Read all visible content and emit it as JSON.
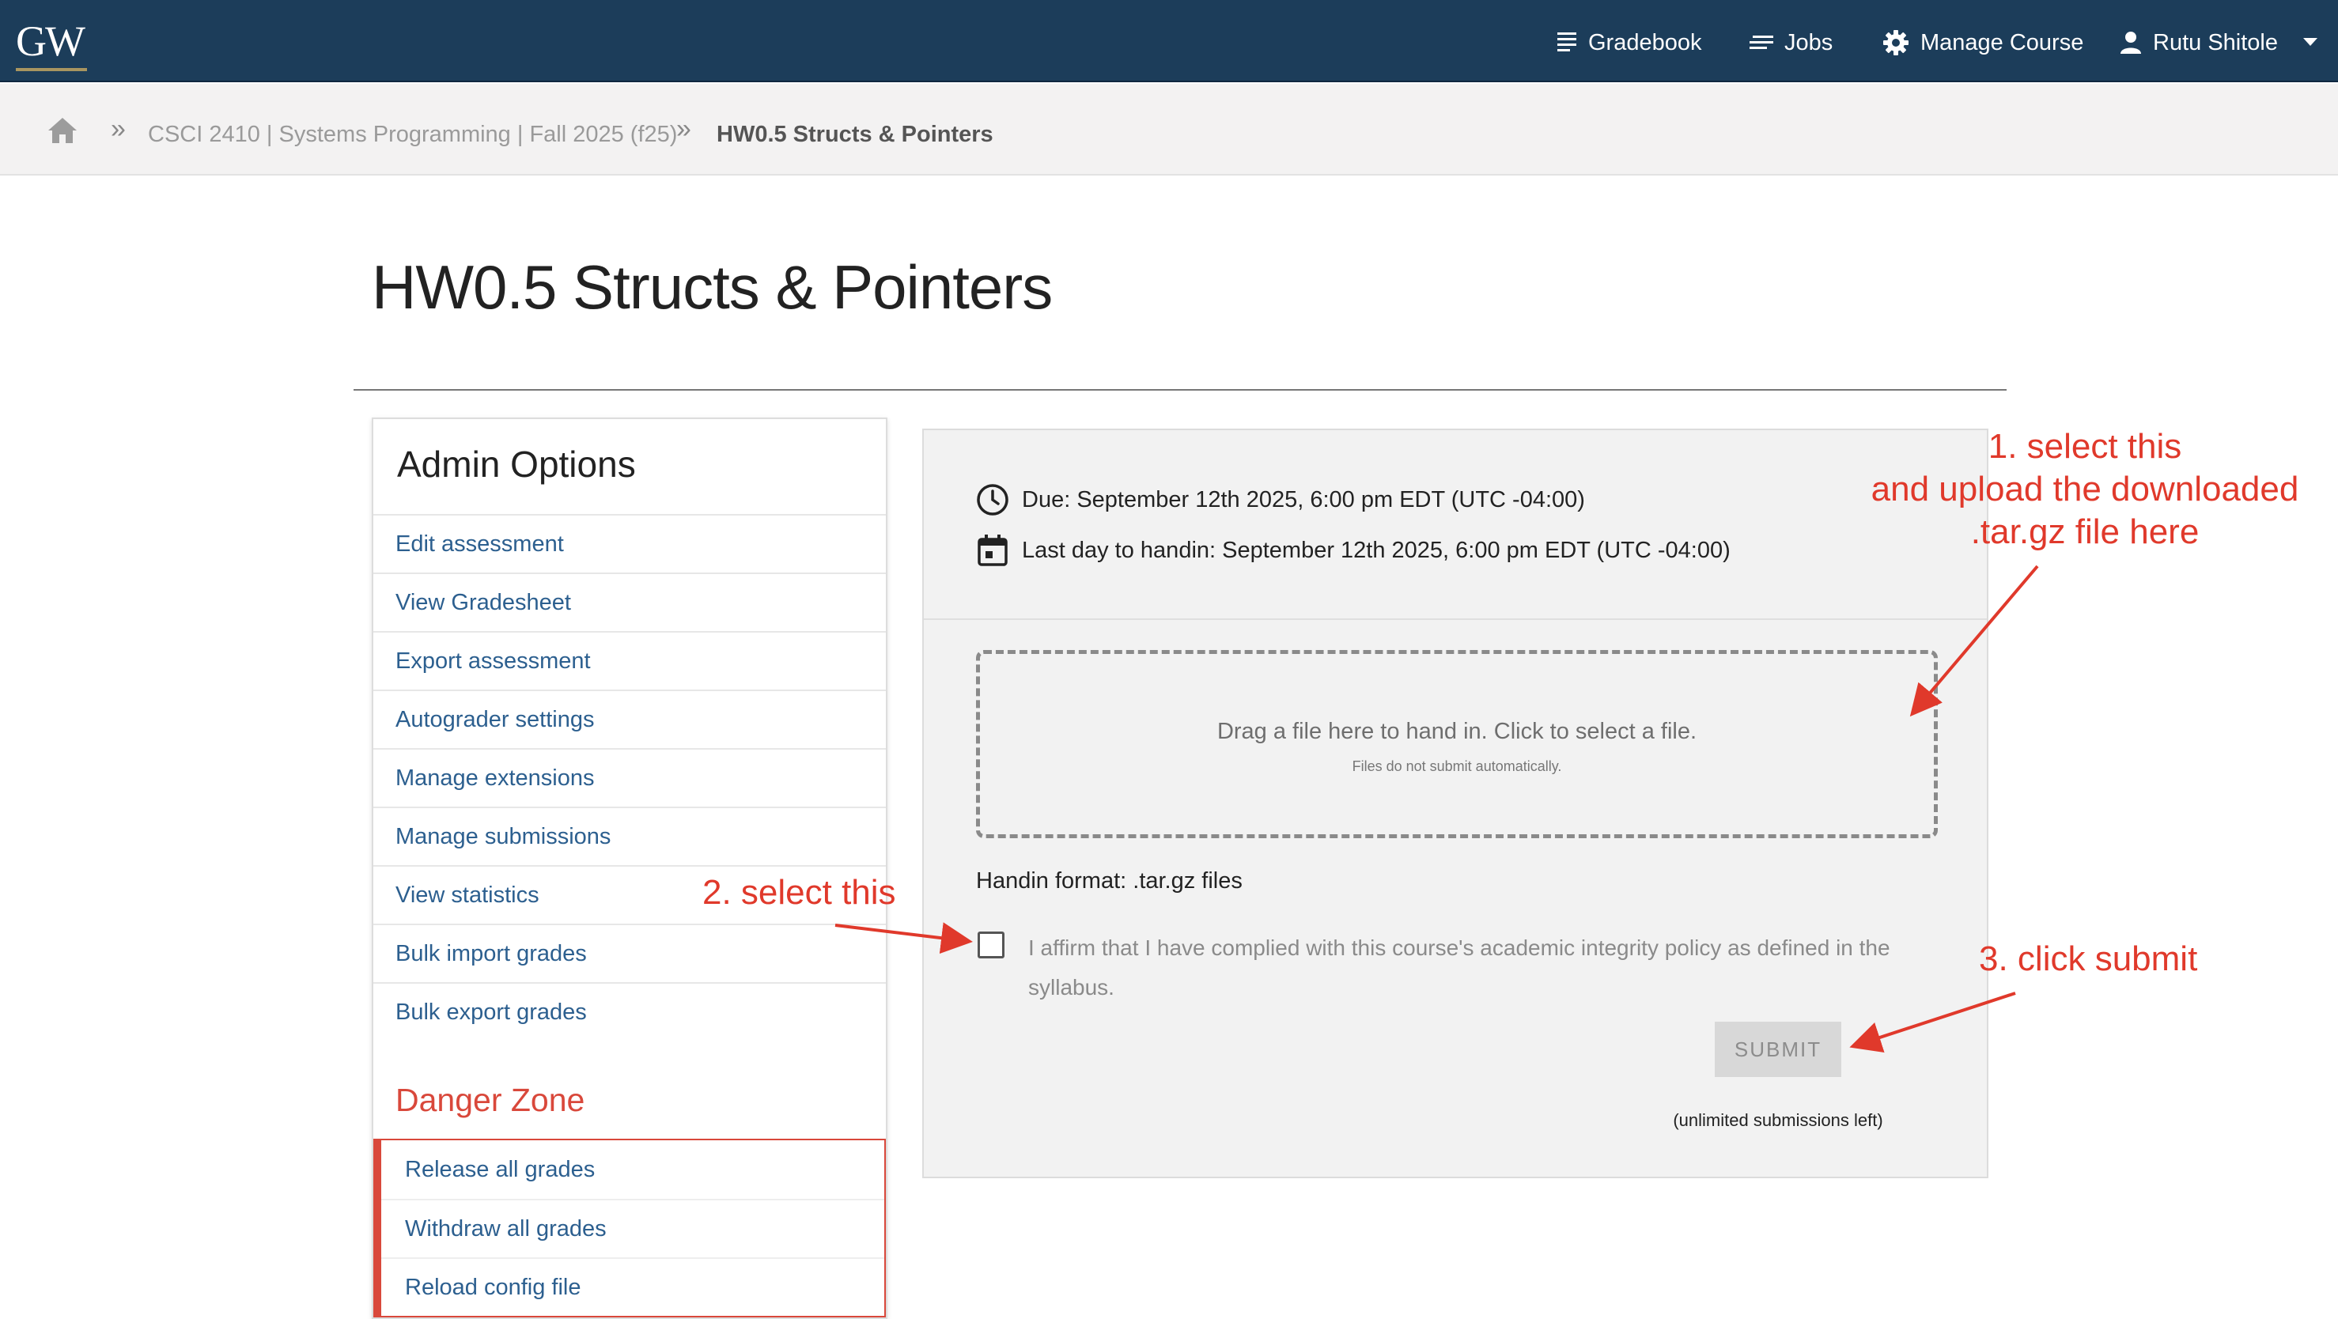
{
  "navbar": {
    "logo_text": "GW",
    "items": [
      {
        "label": "Gradebook",
        "icon": "list-icon"
      },
      {
        "label": "Jobs",
        "icon": "lines-icon"
      },
      {
        "label": "Manage Course",
        "icon": "gear-icon"
      },
      {
        "label": "Rutu Shitole",
        "icon": "user-icon"
      }
    ],
    "caret_icon": "caret-down-icon"
  },
  "breadcrumb": {
    "home_icon": "home-icon",
    "separator": "»",
    "course": "CSCI 2410 | Systems Programming | Fall 2025 (f25)",
    "current": "HW0.5 Structs & Pointers"
  },
  "page": {
    "title": "HW0.5 Structs & Pointers"
  },
  "admin": {
    "title": "Admin Options",
    "items": [
      "Edit assessment",
      "View Gradesheet",
      "Export assessment",
      "Autograder settings",
      "Manage extensions",
      "Manage submissions",
      "View statistics",
      "Bulk import grades",
      "Bulk export grades"
    ],
    "danger_title": "Danger Zone",
    "danger_items": [
      "Release all grades",
      "Withdraw all grades",
      "Reload config file"
    ]
  },
  "submission": {
    "due": "Due: September 12th 2025, 6:00 pm EDT (UTC -04:00)",
    "last_day": "Last day to handin: September 12th 2025, 6:00 pm EDT (UTC -04:00)",
    "dropzone_main": "Drag a file here to hand in. Click to select a file.",
    "dropzone_sub": "Files do not submit automatically.",
    "format": "Handin format: .tar.gz files",
    "affirm": "I affirm that I have complied with this course's academic integrity policy as defined in the syllabus.",
    "submit_label": "SUBMIT",
    "submissions_left": "(unlimited submissions left)"
  },
  "annotations": {
    "step1_line1": "1. select this",
    "step1_line2": "and upload the downloaded",
    "step1_line3": ".tar.gz file here",
    "step2": "2. select this",
    "step3": "3. click submit",
    "color": "#e0392b"
  },
  "colors": {
    "navbar": "#1c3d5a",
    "link": "#2c5f8f",
    "danger": "#d9483b",
    "accent_gold": "#a89560"
  }
}
